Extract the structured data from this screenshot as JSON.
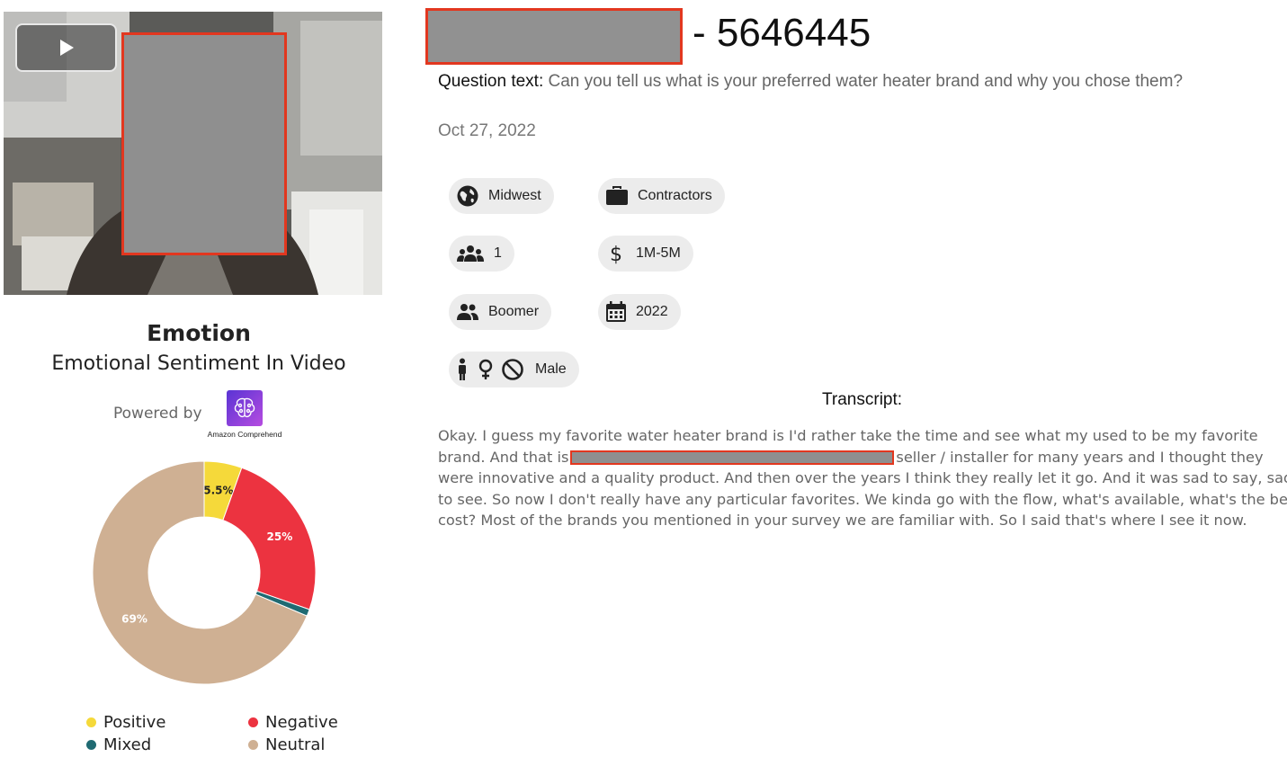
{
  "video": {
    "play_icon": "play-icon"
  },
  "emotion": {
    "title": "Emotion",
    "subtitle": "Emotional Sentiment In Video",
    "powered_by": "Powered by",
    "provider_caption": "Amazon Comprehend",
    "provider_icon": "brain-icon"
  },
  "chart_data": {
    "type": "pie",
    "categories": [
      "Positive",
      "Negative",
      "Mixed",
      "Neutral"
    ],
    "values": [
      5.5,
      25,
      1,
      69
    ],
    "labels": [
      "5.5%",
      "25%",
      "",
      "69%"
    ],
    "colors": [
      "#f5d93a",
      "#ec3340",
      "#1f6a72",
      "#cfb093"
    ],
    "donut": true,
    "legend": [
      {
        "label": "Positive",
        "color": "#f5d93a"
      },
      {
        "label": "Negative",
        "color": "#ec3340"
      },
      {
        "label": "Mixed",
        "color": "#1f6a72"
      },
      {
        "label": "Neutral",
        "color": "#cfb093"
      }
    ]
  },
  "header": {
    "id_text": "- 5646445"
  },
  "question": {
    "label": "Question text:",
    "text": "Can you tell us what is your preferred water heater brand and why you chose them?"
  },
  "date": "Oct 27, 2022",
  "chips": [
    {
      "label": "Midwest",
      "icon": "globe-icon"
    },
    {
      "label": "Contractors",
      "icon": "briefcase-icon"
    },
    {
      "label": "1",
      "icon": "group-icon"
    },
    {
      "label": "1M-5M",
      "icon": "dollar-icon"
    },
    {
      "label": "Boomer",
      "icon": "people-icon"
    },
    {
      "label": "2022",
      "icon": "calendar-icon"
    },
    {
      "label": "Male",
      "icon": "gender-icons"
    }
  ],
  "transcript": {
    "heading": "Transcript:",
    "lines": [
      "Okay. I guess my favorite water heater brand is I'd rather take the time and see what my used to be my favorite",
      "brand. And that is",
      "seller / installer for many years and I thought they",
      "were innovative and a quality product. And then over the years I think they really let it go. And it was sad to say, sad",
      "to see. So now I don't really have any particular favorites. We kinda go with the flow, what's available, what's the best",
      "cost? Most of the brands you mentioned in your survey we are familiar with. So I said that's where I see it now."
    ]
  }
}
